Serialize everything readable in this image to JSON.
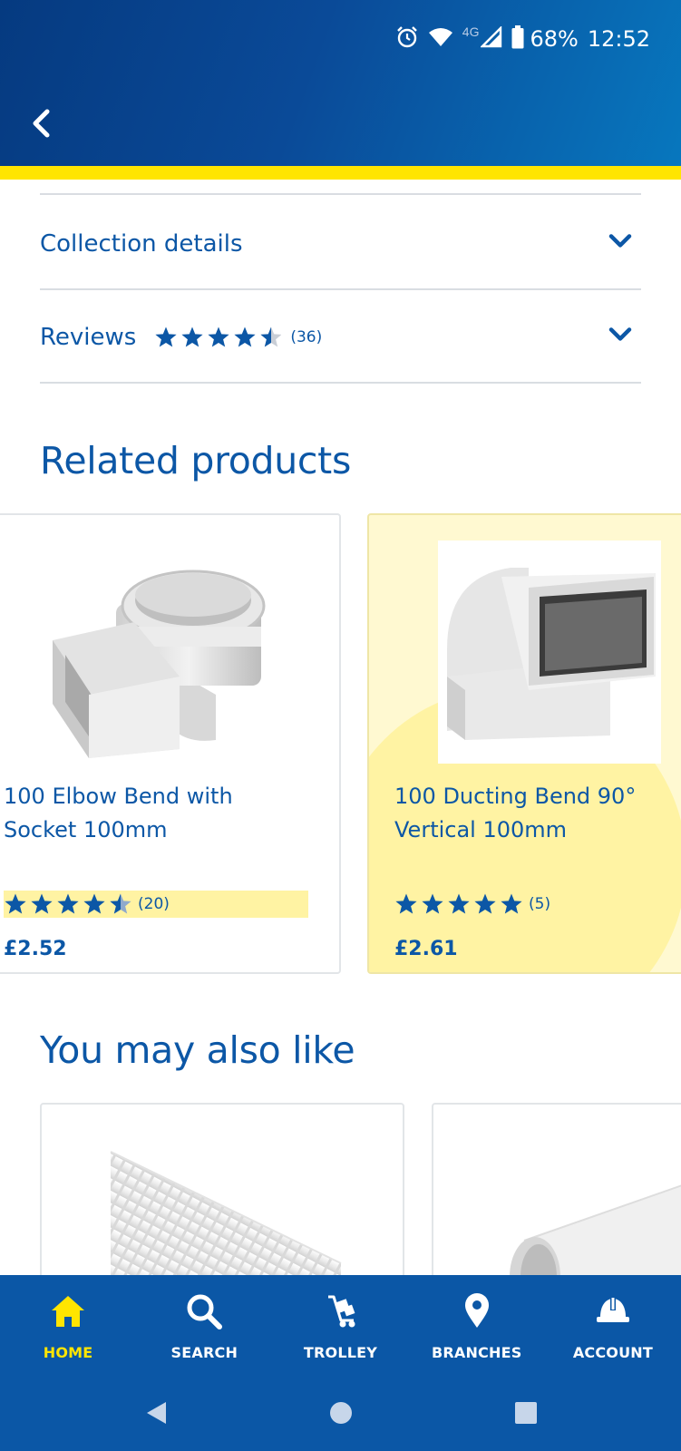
{
  "status_bar": {
    "network": "4G",
    "battery": "68%",
    "time": "12:52"
  },
  "accordions": [
    {
      "label": "Collection details"
    },
    {
      "label": "Reviews",
      "rating": 4.5,
      "count": "(36)"
    }
  ],
  "related": {
    "title": "Related products",
    "products": [
      {
        "name_line1": "100 Elbow Bend with",
        "name_line2": "Socket 100mm",
        "rating": 4.5,
        "count": "(20)",
        "price": "£2.52"
      },
      {
        "name_line1": "100 Ducting Bend 90°",
        "name_line2": "Vertical 100mm",
        "rating": 5,
        "count": "(5)",
        "price": "£2.61"
      }
    ]
  },
  "also_like": {
    "title": "You may also like"
  },
  "bottom_nav": [
    {
      "label": "HOME",
      "icon": "home-icon",
      "active": true
    },
    {
      "label": "SEARCH",
      "icon": "search-icon",
      "active": false
    },
    {
      "label": "TROLLEY",
      "icon": "trolley-icon",
      "active": false
    },
    {
      "label": "BRANCHES",
      "icon": "location-pin-icon",
      "active": false
    },
    {
      "label": "ACCOUNT",
      "icon": "hard-hat-icon",
      "active": false
    }
  ],
  "colors": {
    "brand_blue": "#0c57a6",
    "brand_yellow": "#ffe500",
    "nav_blue": "#0b57a6"
  }
}
